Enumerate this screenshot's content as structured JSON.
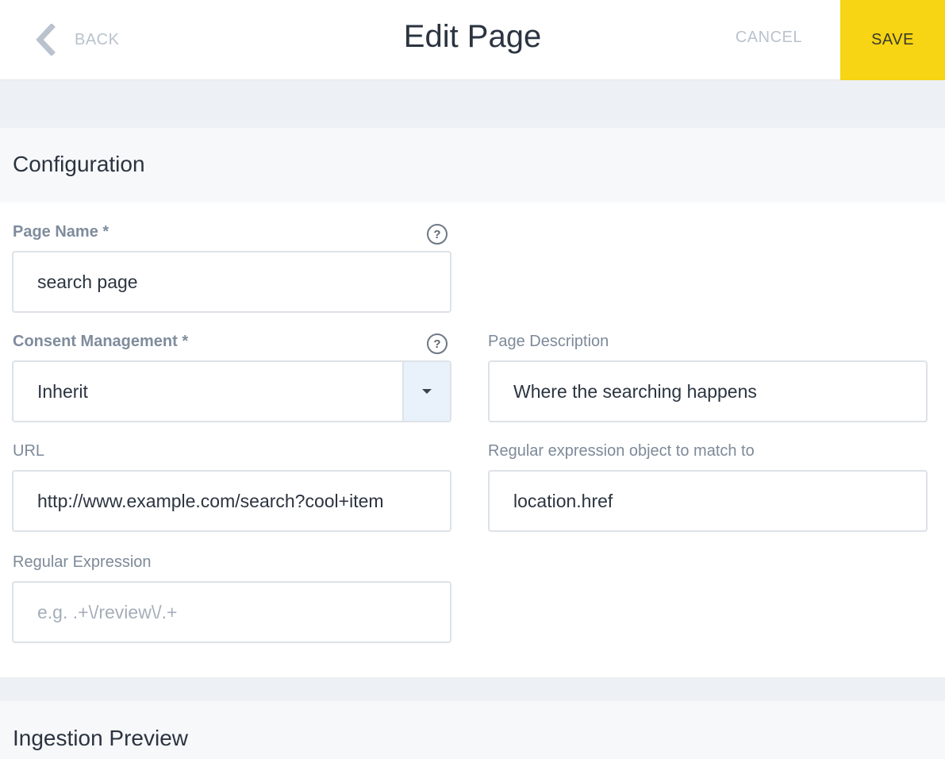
{
  "header": {
    "back_label": "BACK",
    "back_icon": "chevron-left-icon",
    "title": "Edit Page",
    "cancel_label": "CANCEL",
    "save_label": "SAVE",
    "save_color": "#f7d414"
  },
  "configuration": {
    "section_title": "Configuration",
    "page_name": {
      "label": "Page Name *",
      "value": "search page",
      "help": "?"
    },
    "consent_management": {
      "label": "Consent Management *",
      "value": "Inherit",
      "help": "?"
    },
    "page_description": {
      "label": "Page Description",
      "value": "Where the searching happens"
    },
    "url": {
      "label": "URL",
      "value": "http://www.example.com/search?cool+item"
    },
    "regex_object": {
      "label": "Regular expression object to match to",
      "value": "location.href"
    },
    "regex": {
      "label": "Regular Expression",
      "placeholder": "e.g. .+\\/review\\/.+"
    }
  },
  "ingestion_preview": {
    "section_title": "Ingestion Preview"
  }
}
